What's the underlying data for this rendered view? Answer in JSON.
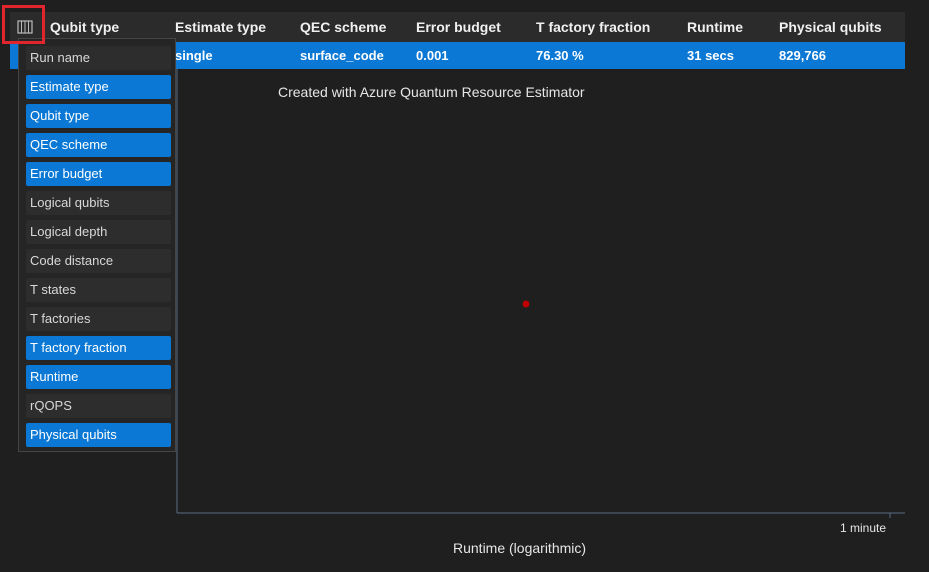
{
  "table": {
    "headers": [
      "Qubit type",
      "Estimate type",
      "QEC scheme",
      "Error budget",
      "T factory fraction",
      "Runtime",
      "Physical qubits"
    ],
    "row": [
      "single",
      "surface_code",
      "0.001",
      "76.30 %",
      "31 secs",
      "829,766"
    ]
  },
  "chart": {
    "title": "Created with Azure Quantum Resource Estimator",
    "xtick_label": "1 minute",
    "xlabel": "Runtime (logarithmic)",
    "point_color": "#c00000",
    "axis_color": "#5a6e86"
  },
  "column_menu": {
    "items": [
      {
        "label": "Run name",
        "selected": false
      },
      {
        "label": "Estimate type",
        "selected": true
      },
      {
        "label": "Qubit type",
        "selected": true
      },
      {
        "label": "QEC scheme",
        "selected": true
      },
      {
        "label": "Error budget",
        "selected": true
      },
      {
        "label": "Logical qubits",
        "selected": false
      },
      {
        "label": "Logical depth",
        "selected": false
      },
      {
        "label": "Code distance",
        "selected": false
      },
      {
        "label": "T states",
        "selected": false
      },
      {
        "label": "T factories",
        "selected": false
      },
      {
        "label": "T factory fraction",
        "selected": true
      },
      {
        "label": "Runtime",
        "selected": true
      },
      {
        "label": "rQOPS",
        "selected": false
      },
      {
        "label": "Physical qubits",
        "selected": true
      }
    ]
  }
}
